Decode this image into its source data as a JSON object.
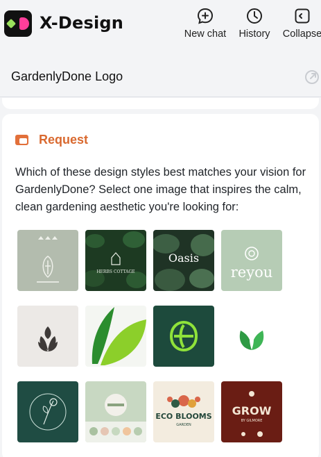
{
  "header": {
    "brand": "X-Design",
    "logo_mark": "X-D",
    "actions": {
      "new_chat": "New chat",
      "history": "History",
      "collapse": "Collapse"
    }
  },
  "conversation": {
    "title": "GardenlyDone Logo"
  },
  "request": {
    "heading": "Request",
    "text": "Which of these design styles best matches your vision for GardenlyDone? Select one image that inspires the calm, clean gardening aesthetic you're looking for:",
    "images": [
      {
        "label": ""
      },
      {
        "label": "HERBS COTTAGE"
      },
      {
        "label": "Oasis"
      },
      {
        "label": "reyou"
      },
      {
        "label": ""
      },
      {
        "label": ""
      },
      {
        "label": ""
      },
      {
        "label": ""
      },
      {
        "label": ""
      },
      {
        "label": ""
      },
      {
        "label": "ECO BLOOMS",
        "sub": "GARDEN"
      },
      {
        "label": "GROW",
        "sub": "BY GILMORE"
      }
    ]
  },
  "colors": {
    "accent": "#d9692f",
    "background": "#f3f4f6",
    "card": "#ffffff"
  }
}
